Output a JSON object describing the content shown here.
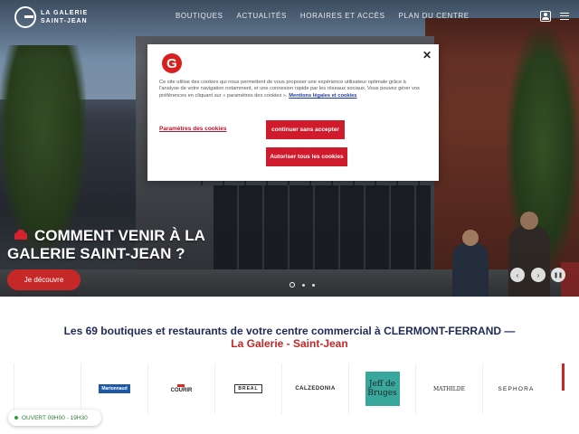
{
  "header": {
    "logo_line1": "LA GALERIE",
    "logo_line2": "SAINT-JEAN",
    "nav": [
      "BOUTIQUES",
      "ACTUALITÉS",
      "HORAIRES ET ACCÈS",
      "PLAN DU CENTRE"
    ],
    "icons": [
      "user-icon",
      "menu-icon"
    ]
  },
  "hero": {
    "title": "COMMENT VENIR À LA GALERIE SAINT-JEAN ?",
    "cta": "Je découvre",
    "prev": "‹",
    "next": "›",
    "pause": "❚❚",
    "slide_count": 3,
    "active_slide": 1
  },
  "cookie": {
    "logo_letter": "G",
    "close": "✕",
    "text": "Ce site utilise des cookies qui nous permettent de vous proposer une expérience utilisateur optimale grâce à l'analyse de votre navigation notamment, et une connexion rapide par les réseaux sociaux. Vous pouvez gérer vos préférences en cliquant sur « paramètres des cookies ».",
    "legal_link": "Mentions légales et cookies",
    "settings_link": "Paramètres des cookies",
    "continue_btn": "continuer sans accepter",
    "accept_btn": "Autoriser tous les cookies"
  },
  "section": {
    "title_prefix": "Les 69 boutiques et restaurants de votre centre commercial à ",
    "city": "CLERMONT-FERRAND",
    "separator": " — ",
    "mall_name": "La Galerie - Saint-Jean"
  },
  "brands": [
    "Marionnaud",
    "COURIR",
    "BREAL",
    "CALZEDONIA",
    "Jeff de Bruges",
    "MATHILDE",
    "SEPHORA"
  ],
  "open_status": "OUVERT 09H00 - 19H30",
  "colors": {
    "accent_red": "#c62828",
    "navy": "#1e2a55",
    "open_green": "#2e7d32"
  }
}
